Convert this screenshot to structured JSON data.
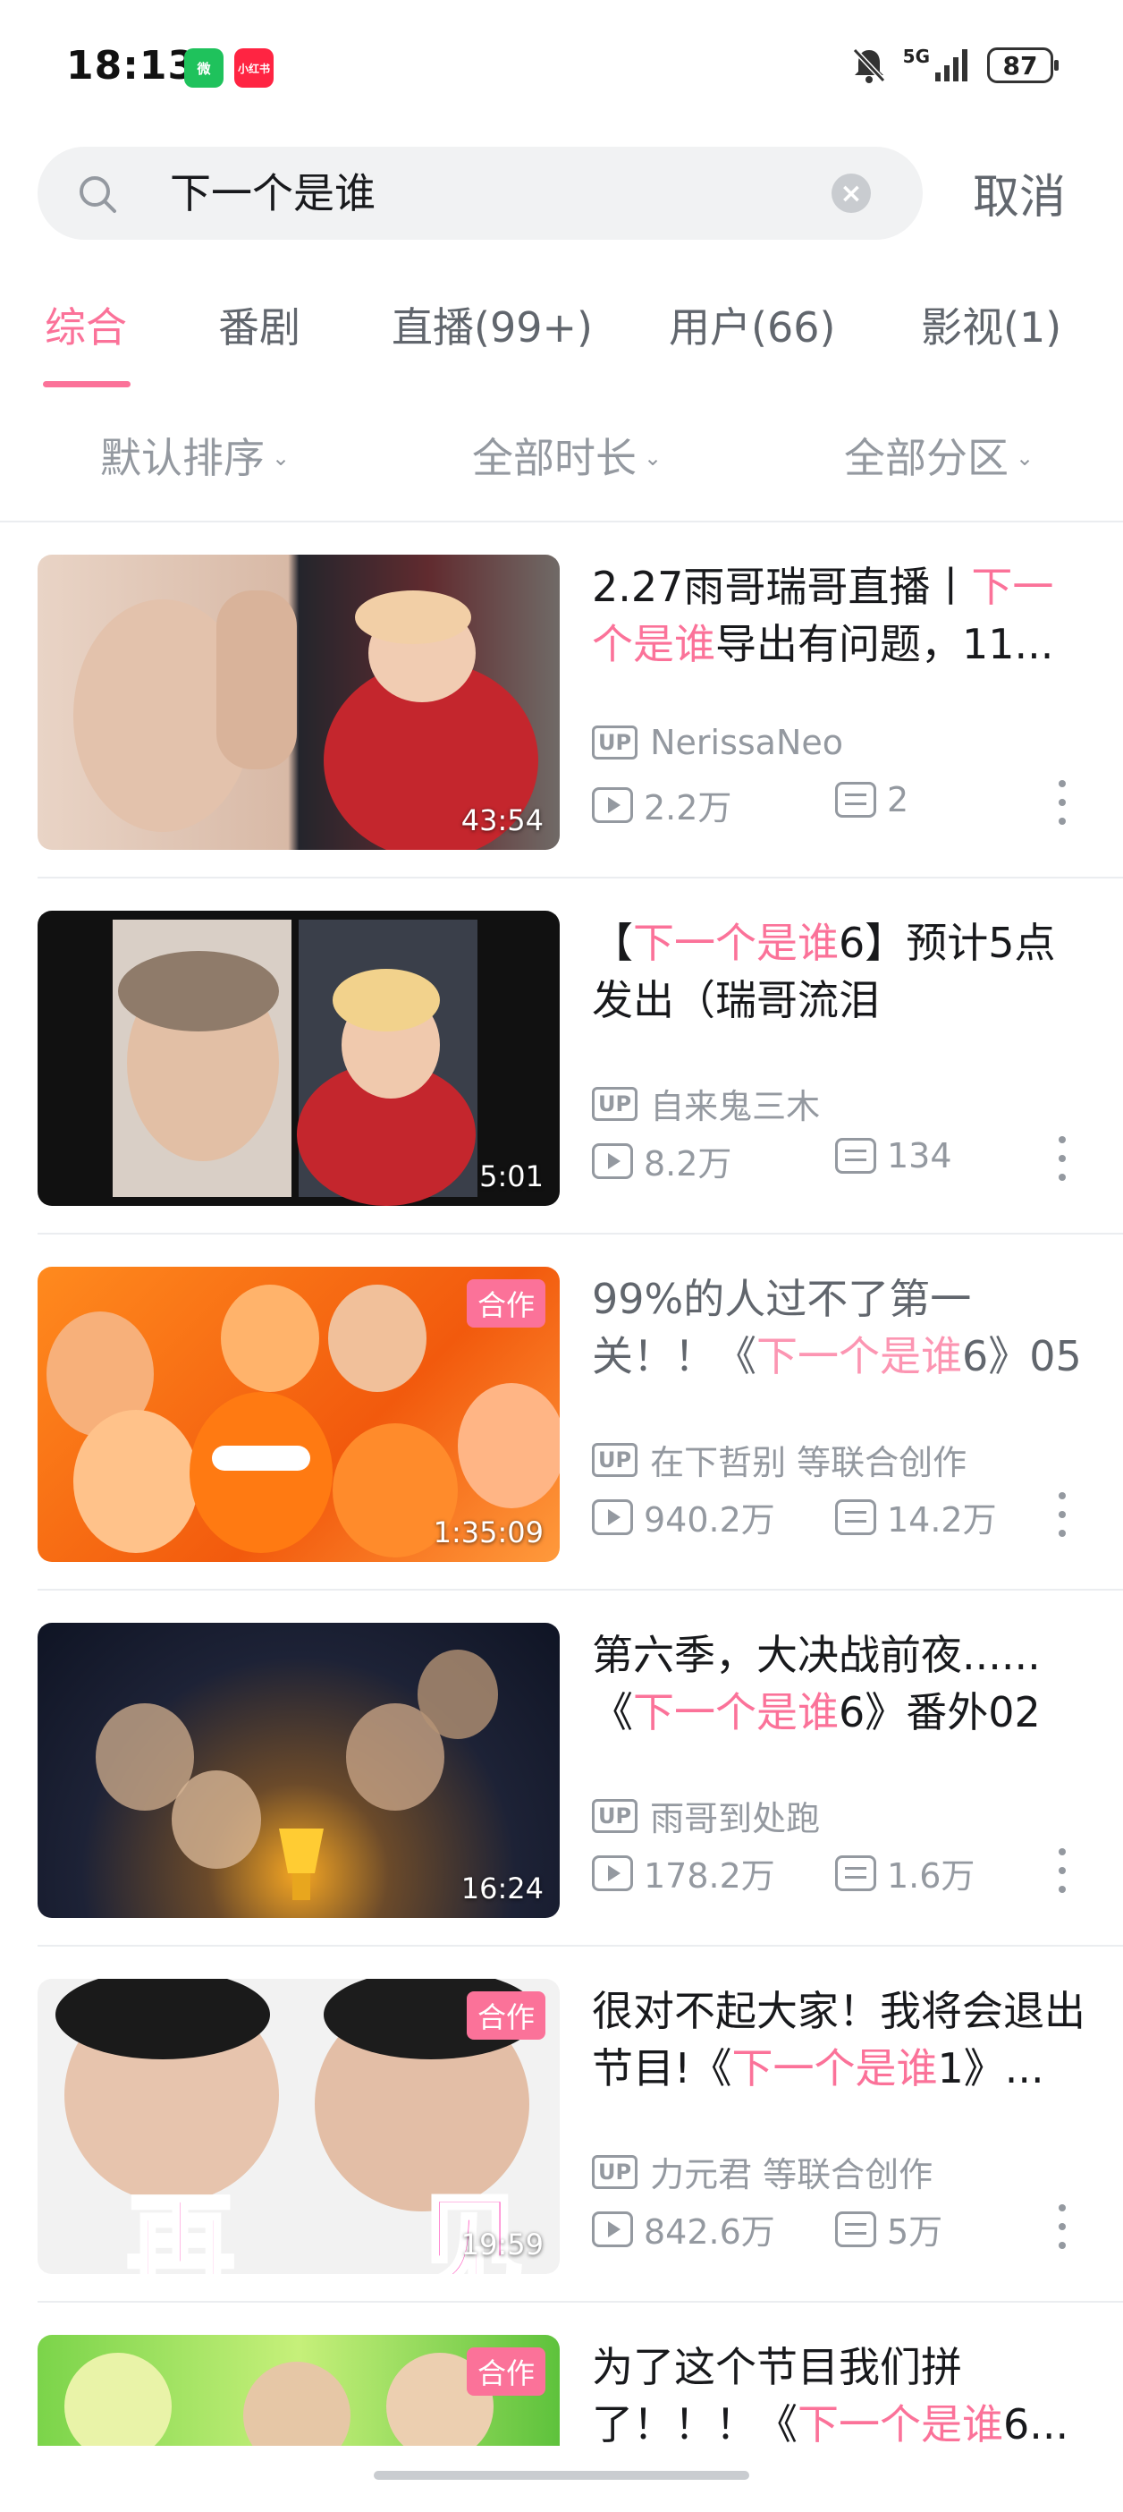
{
  "status_bar": {
    "time": "18:13",
    "app1_label": "微",
    "app2_label": "小红书",
    "network": "5G",
    "battery": "87"
  },
  "search": {
    "query": "下一个是谁",
    "cancel_label": "取消"
  },
  "tabs": [
    {
      "label": "综合"
    },
    {
      "label": "番剧"
    },
    {
      "label": "直播(99+)"
    },
    {
      "label": "用户(66)"
    },
    {
      "label": "影视(1)"
    }
  ],
  "filters": [
    {
      "label": "默认排序"
    },
    {
      "label": "全部时长"
    },
    {
      "label": "全部分区"
    }
  ],
  "results": [
    {
      "title_pre": "2.27雨哥瑞哥直播丨",
      "title_hl": "下一个是谁",
      "title_post": "导出有问题，11...",
      "uploader": "NerissaNeo",
      "views": "2.2万",
      "danmaku": "2",
      "duration": "43:54",
      "coop": ""
    },
    {
      "title_pre": "【",
      "title_hl": "下一个是谁",
      "title_post": "6】预计5点发出（瑞哥流泪",
      "uploader": "自来鬼三木",
      "views": "8.2万",
      "danmaku": "134",
      "duration": "5:01",
      "coop": ""
    },
    {
      "title_pre": "99%的人过不了第一关！！《",
      "title_hl": "下一个是谁",
      "title_post": "6》05",
      "uploader": "在下哲别 等联合创作",
      "views": "940.2万",
      "danmaku": "14.2万",
      "duration": "1:35:09",
      "coop": "合作"
    },
    {
      "title_pre": "第六季，大决战前夜......《",
      "title_hl": "下一个是谁",
      "title_post": "6》番外02",
      "uploader": "雨哥到处跑",
      "views": "178.2万",
      "danmaku": "1.6万",
      "duration": "16:24",
      "coop": ""
    },
    {
      "title_pre": "很对不起大家！我将会退出节目!《",
      "title_hl": "下一个是谁",
      "title_post": "1》...",
      "uploader": "力元君 等联合创作",
      "views": "842.6万",
      "danmaku": "5万",
      "duration": "19:59",
      "coop": "合作",
      "thumb_text": "再  见"
    },
    {
      "title_pre": "为了这个节目我们拼了！！！《",
      "title_hl": "下一个是谁",
      "title_post": "6...",
      "uploader": "",
      "views": "",
      "danmaku": "",
      "duration": "",
      "coop": "合作"
    }
  ],
  "up_badge": "UP",
  "colors": {
    "accent": "#fb7299",
    "text": "#18191c",
    "secondary": "#9499a0"
  }
}
